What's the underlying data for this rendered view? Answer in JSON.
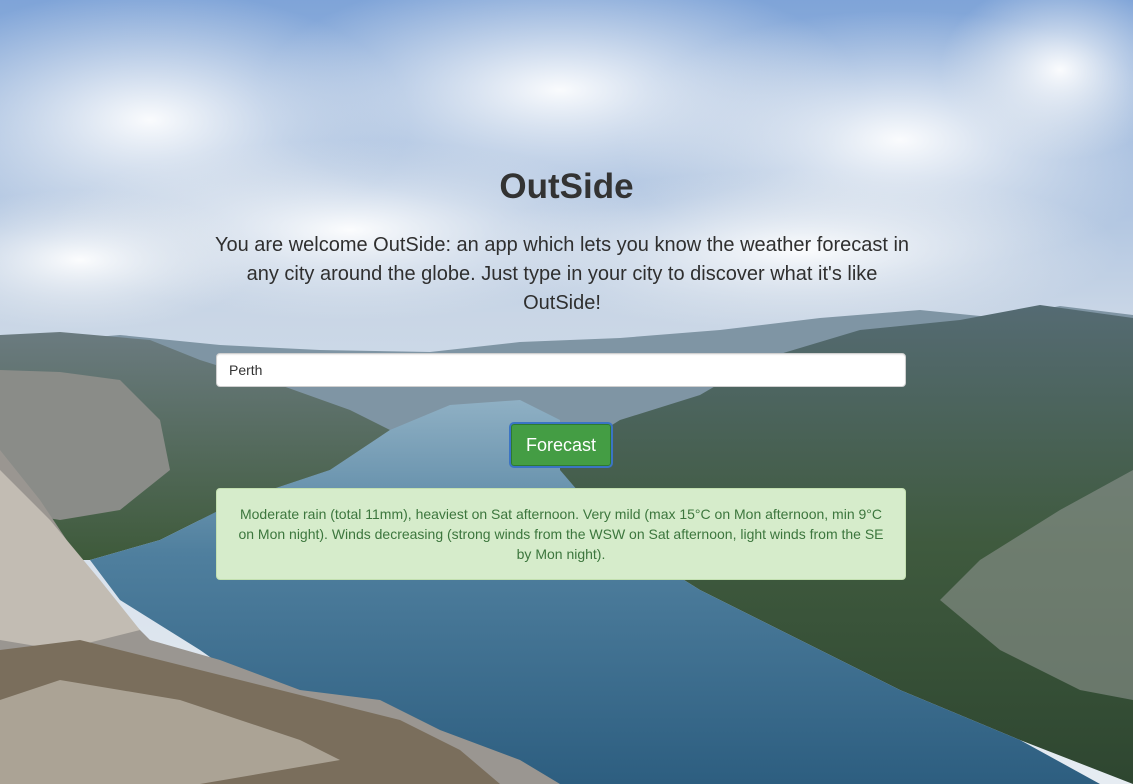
{
  "page": {
    "title": "OutSide",
    "intro": "You are welcome OutSide: an app which lets you know the weather forecast in any city around the globe. Just type in your city to discover what it's like OutSide!"
  },
  "search": {
    "city_value": "Perth"
  },
  "actions": {
    "forecast_label": "Forecast"
  },
  "result": {
    "forecast_text": "Moderate rain (total 11mm), heaviest on Sat afternoon. Very mild (max 15°C on Mon afternoon, min 9°C on Mon night). Winds decreasing (strong winds from the WSW on Sat afternoon, light winds from the SE by Mon night)."
  },
  "colors": {
    "button_green": "#449d44",
    "alert_background": "#d6eccb",
    "alert_text": "#3c763d",
    "title_text": "#333333"
  },
  "background": {
    "scene": "fjord-landscape-with-clouds"
  }
}
